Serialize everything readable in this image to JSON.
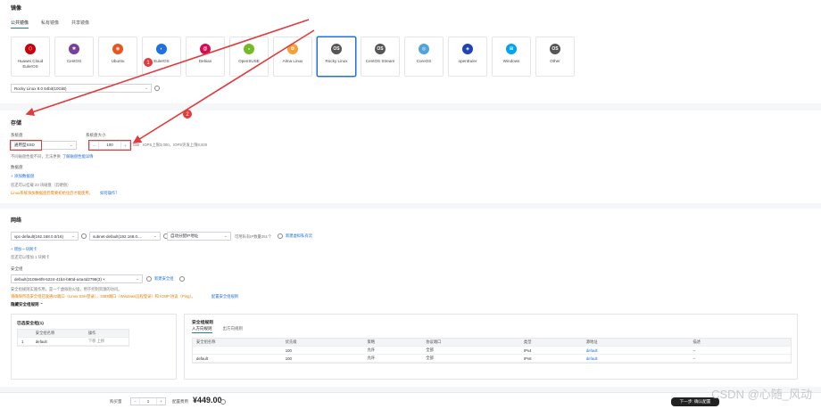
{
  "image_section": {
    "title": "镜像",
    "tabs": [
      "公共镜像",
      "私有镜像",
      "共享镜像"
    ],
    "os_list": [
      {
        "name": "Huawei Cloud EulerOS",
        "color": "#c7000b",
        "glyph": "⬡"
      },
      {
        "name": "CentOS",
        "color": "#7a3e9d",
        "glyph": "✱"
      },
      {
        "name": "Ubuntu",
        "color": "#e95420",
        "glyph": "◉"
      },
      {
        "name": "EulerOS",
        "color": "#1f6fe5",
        "glyph": "◐"
      },
      {
        "name": "Debian",
        "color": "#d70a53",
        "glyph": "@"
      },
      {
        "name": "OpenSUSE",
        "color": "#73ba25",
        "glyph": "◒"
      },
      {
        "name": "Alma Linux",
        "color": "#f3a23b",
        "glyph": "✿"
      },
      {
        "name": "Rocky Linux",
        "color": "#555555",
        "glyph": "OS"
      },
      {
        "name": "CentOS Stream",
        "color": "#555555",
        "glyph": "OS"
      },
      {
        "name": "CoreOS",
        "color": "#53a3da",
        "glyph": "◎"
      },
      {
        "name": "openEuler",
        "color": "#2043b5",
        "glyph": "◈"
      },
      {
        "name": "Windows",
        "color": "#00a4ef",
        "glyph": "⊞"
      },
      {
        "name": "Other",
        "color": "#555555",
        "glyph": "OS"
      }
    ],
    "selected_index": 7,
    "image_version": "Rocky Linux 8.0 64bit(10GiB)"
  },
  "arrows": {
    "one": "1",
    "two": "2"
  },
  "storage": {
    "title": "存储",
    "system_disk_label": "系统盘",
    "system_disk_size_label": "系统盘大小",
    "disk_type": "通用型SSD",
    "size_value": "100",
    "size_unit": "GiB",
    "size_hint": "IOPS上限3,000，IOPS突发上限8,000",
    "disk_note": "不同磁盘性能不同，无法更换",
    "disk_note_link": "了解磁盘性能详情",
    "data_disk_label": "数据盘",
    "add_data_disk": "+ 添加数据盘",
    "data_disk_count": "您还可以挂载 23 块磁盘（云硬盘）",
    "warning": "Linux系统添加数据盘后需要初始化后才能使用，",
    "warning_link": "如何操作？"
  },
  "network": {
    "title": "网络",
    "vpc": "vpc-default(192.168.0.0/16)",
    "subnet": "subnet-default(192.168.0....",
    "ip_mode": "自动分配IP地址",
    "available_ip": "可用私有IP数量251个",
    "create_vpc_link": "新建虚拟私有云",
    "add_nic": "+ 增加一块网卡",
    "nic_count": "您还可以增加 1 块网卡",
    "security_group_label": "安全组",
    "security_group_value": "default(3108e6f8-5224-41b4-b80d-a4a4d2798(3) ×",
    "create_sg_link": "新建安全组",
    "sg_note": "安全组规则实施作用，是一个虚拟防火墙，用于控制资源的访问。",
    "sg_warning": "请确保所选安全组已放通22端口（Linux SSH登录），3389端口（Windows远程登录）和 ICMP 协议（Ping）。",
    "sg_warning_link": "配置安全组规则",
    "collapse_label": "隐藏安全组规则",
    "selected_sg_title": "已选安全组(1)",
    "selected_sg_headers": [
      "",
      "安全组名称",
      "操作"
    ],
    "selected_sg_rows": [
      [
        "1",
        "default",
        "下移  上移"
      ]
    ],
    "rules_title": "安全组规则",
    "rules_tabs": [
      "入方向规则",
      "出方向规则"
    ],
    "rules_headers": [
      "安全组名称",
      "优先级",
      "策略",
      "协议端口",
      "类型",
      "源地址",
      "描述"
    ],
    "rules_rows": [
      [
        "",
        "100",
        "允许",
        "全部",
        "IPv4",
        "default",
        "--"
      ],
      [
        "default",
        "100",
        "允许",
        "全部",
        "IPv6",
        "default",
        "--"
      ]
    ]
  },
  "footer": {
    "duration_label": "购买量",
    "quantity": "1",
    "price_label": "配置费用",
    "price": "¥449.00",
    "next_button": "下一步: 确认配置"
  },
  "watermark": "CSDN @心随_风动"
}
